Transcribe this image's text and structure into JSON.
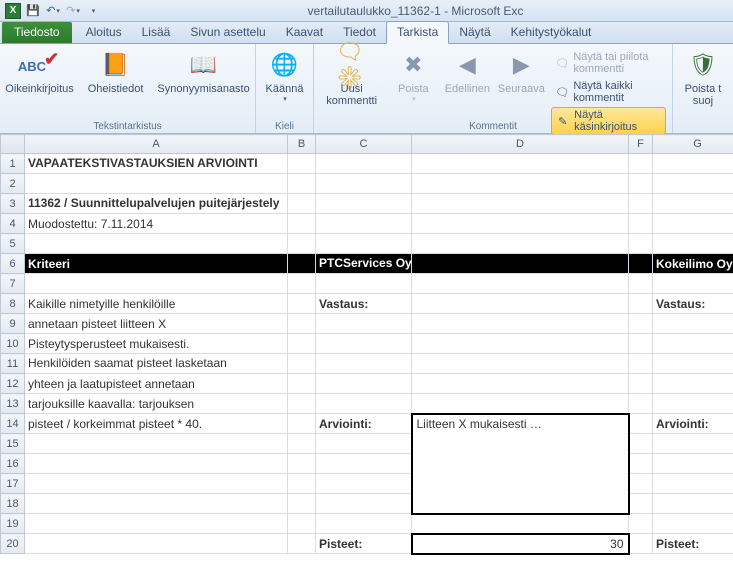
{
  "titlebar": {
    "title": "vertailutaulukko_11362-1  -  Microsoft Exc"
  },
  "tabs": {
    "file": "Tiedosto",
    "items": [
      "Aloitus",
      "Lisää",
      "Sivun asettelu",
      "Kaavat",
      "Tiedot",
      "Tarkista",
      "Näytä",
      "Kehitystyökalut"
    ],
    "active_index": 5
  },
  "ribbon": {
    "proofing": {
      "label": "Tekstintarkistus",
      "spelling": "Oikeinkirjoitus",
      "research": "Oheistiedot",
      "thesaurus": "Synonyymisanasto"
    },
    "language": {
      "label": "Kieli",
      "translate": "Käännä"
    },
    "comments": {
      "label": "Kommentit",
      "new": "Uusi kommentti",
      "delete": "Poista",
      "prev": "Edellinen",
      "next": "Seuraava",
      "showhide": "Näytä tai piilota kommentti",
      "showall": "Näytä kaikki kommentit",
      "ink": "Näytä käsinkirjoitus"
    },
    "changes": {
      "protect": "Poista t",
      "protect2": "suoj"
    }
  },
  "cols": [
    "A",
    "B",
    "C",
    "D",
    "F",
    "G"
  ],
  "rows": {
    "r1": {
      "a": "VAPAATEKSTIVASTAUKSIEN ARVIOINTI"
    },
    "r3": {
      "a": "11362 / Suunnittelupalvelujen puitejärjestely"
    },
    "r4": {
      "a": "Muodostettu: 7.11.2014"
    },
    "r6": {
      "a": "Kriteeri",
      "c": "PTCServices Oy",
      "g": "Kokeilimo Oy"
    },
    "r8": {
      "a": "Kaikille nimetyille henkilöille",
      "c": "Vastaus:",
      "g": "Vastaus:"
    },
    "r9": {
      "a": "annetaan pisteet liitteen X"
    },
    "r10": {
      "a": "Pisteytysperusteet mukaisesti."
    },
    "r11": {
      "a": "Henkilöiden saamat pisteet lasketaan"
    },
    "r12": {
      "a": "yhteen ja laatupisteet annetaan"
    },
    "r13": {
      "a": "tarjouksille kaavalla: tarjouksen"
    },
    "r14": {
      "a": "pisteet / korkeimmat pisteet * 40.",
      "c": "Arviointi:",
      "d": "Liitteen X mukaisesti …",
      "g": "Arviointi:"
    },
    "r20": {
      "c": "Pisteet:",
      "d": "30",
      "g": "Pisteet:"
    }
  }
}
